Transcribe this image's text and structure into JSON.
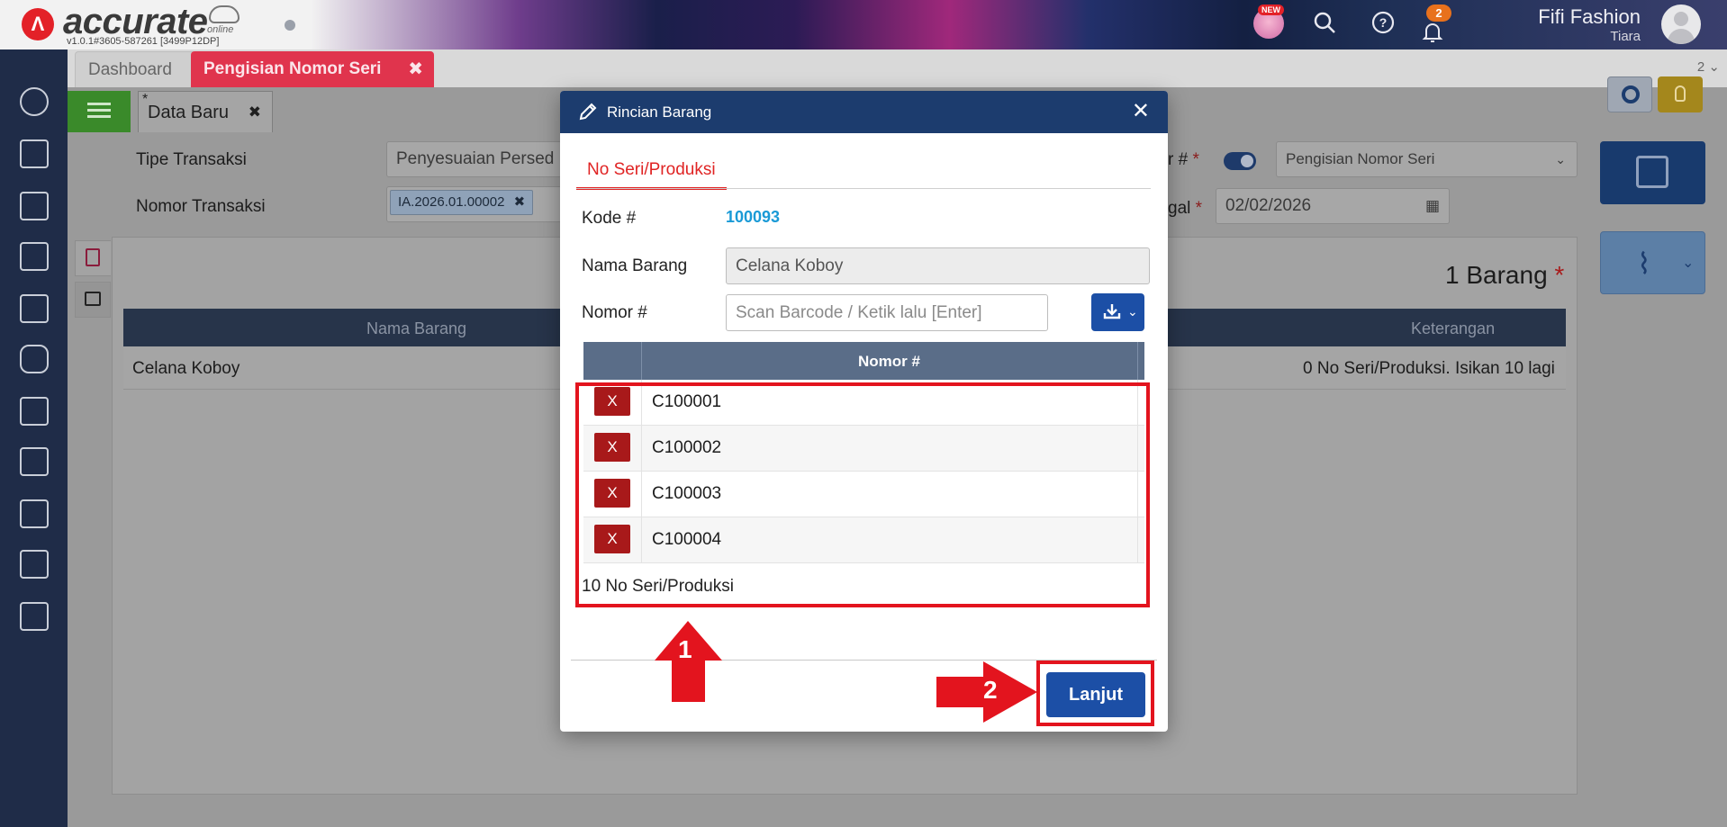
{
  "app": {
    "logo_text": "accurate",
    "logo_sub": "online",
    "version": "v1.0.1#3605-587261 [3499P12DP]",
    "new_badge": "NEW",
    "notifications_count": "2",
    "company_name": "Fifi Fashion",
    "user_name": "Tiara"
  },
  "tabs": {
    "dashboard": "Dashboard",
    "active": "Pengisian Nomor Seri",
    "active_close": "✖",
    "count": "2 ⌄"
  },
  "subtabs": {
    "data_baru": "Data Baru",
    "asterisk": "*",
    "close": "✖"
  },
  "form": {
    "tipe_transaksi_label": "Tipe Transaksi",
    "tipe_transaksi_value": "Penyesuaian Persed",
    "nomor_transaksi_label": "Nomor Transaksi",
    "nomor_transaksi_chip": "IA.2026.01.00002",
    "chip_close": "✖",
    "tipe_partial_label": "r #",
    "required_star": "*",
    "tipe_select_value": "Pengisian Nomor Seri",
    "tanggal_partial_label": "gal",
    "tanggal_value": "02/02/2026"
  },
  "grid": {
    "count_label": "1 Barang",
    "col_nama": "Nama Barang",
    "col_keterangan": "Keterangan",
    "row_nama": "Celana Koboy",
    "row_keterangan": "0 No Seri/Produksi. Isikan 10 lagi"
  },
  "modal": {
    "title": "Rincian Barang",
    "close": "✕",
    "tab": "No Seri/Produksi",
    "kode_label": "Kode #",
    "kode_value": "100093",
    "nama_label": "Nama Barang",
    "nama_value": "Celana Koboy",
    "nomor_label": "Nomor #",
    "nomor_placeholder": "Scan Barcode / Ketik lalu [Enter]",
    "list_header": "Nomor #",
    "delete_label": "X",
    "serials": [
      "C100001",
      "C100002",
      "C100003",
      "C100004"
    ],
    "footer_count": "10 No Seri/Produksi",
    "lanjut_label": "Lanjut"
  },
  "annotations": {
    "arrow_1": "1",
    "arrow_2": "2",
    "color": "#e3141e"
  },
  "colors": {
    "modal_header": "#1c3c6e",
    "primary_button": "#1c4fa6",
    "active_tab": "#e0344d",
    "delete_button": "#a8191a",
    "kode_value": "#1a9ad6"
  }
}
